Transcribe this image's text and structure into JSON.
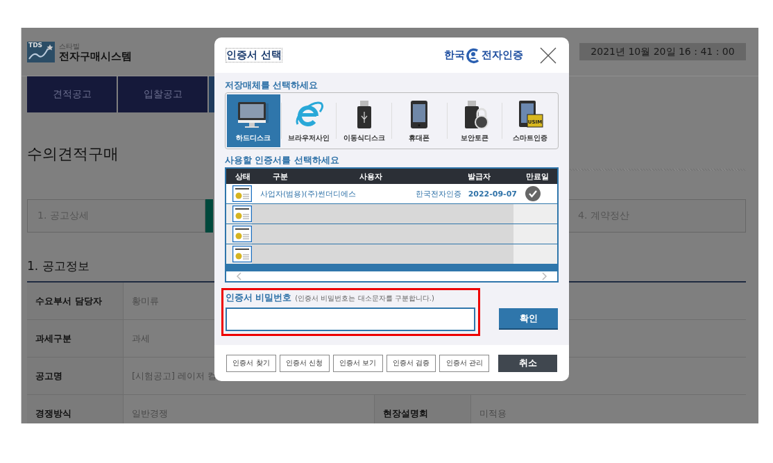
{
  "page": {
    "logo": {
      "badge": "TDS",
      "subtitle": "스타빌",
      "title": "전자구매시스템"
    },
    "datetime": "2021년 10월 20일 16 : 41 : 00",
    "nav_tabs": [
      {
        "label": "견적공고",
        "selected": false
      },
      {
        "label": "입찰공고",
        "selected": false
      },
      {
        "selected": true
      }
    ],
    "heading": "수의견적구매",
    "steps": [
      {
        "label": "1. 공고상세"
      },
      {
        "label": "4. 계약정산"
      }
    ],
    "section_title": "1. 공고정보",
    "info_rows": [
      {
        "cells": [
          {
            "label": "수요부서 담당자",
            "value": "황미류"
          }
        ]
      },
      {
        "cells": [
          {
            "label": "과세구분",
            "value": "과세"
          }
        ]
      },
      {
        "cells": [
          {
            "label": "공고명",
            "value": "[시험공고] 레이저 컬"
          }
        ]
      },
      {
        "cells": [
          {
            "label": "경쟁방식",
            "value": "일반경쟁"
          },
          {
            "label": "현장설명회",
            "value": "미적용"
          }
        ]
      }
    ]
  },
  "modal": {
    "title": "인증서 선택",
    "brand": {
      "left": "한국",
      "right": "전자인증"
    },
    "media_label": "저장매체를 선택하세요",
    "media": [
      {
        "label": "하드디스크",
        "kind": "monitor",
        "selected": true
      },
      {
        "label": "브라우저사인",
        "kind": "browser",
        "selected": false
      },
      {
        "label": "이동식디스크",
        "kind": "usb",
        "selected": false
      },
      {
        "label": "휴대폰",
        "kind": "phone",
        "selected": false
      },
      {
        "label": "보안토큰",
        "kind": "token",
        "selected": false
      },
      {
        "label": "스마트인증",
        "kind": "smartcard",
        "chip_text": "USIM",
        "selected": false
      }
    ],
    "cert_label": "사용할 인증서를 선택하세요",
    "cert_columns": [
      "상태",
      "구분",
      "사용자",
      "발급자",
      "만료일"
    ],
    "certs": [
      {
        "name": "사업자(범용)(주)썬더디에스",
        "issuer": "한국전자인증",
        "expiry": "2022-09-07",
        "selected": true
      },
      {
        "selected": false
      },
      {
        "selected": false
      },
      {
        "selected": false
      }
    ],
    "password": {
      "label": "인증서 비밀번호",
      "hint": "(인증서 비밀번호는 대소문자를 구분합니다.)",
      "highlighted": true
    },
    "confirm": "확인",
    "footer_buttons": [
      "인증서 찾기",
      "인증서 신청",
      "인증서 보기",
      "인증서 검증",
      "인증서 관리"
    ],
    "cancel": "취소"
  }
}
